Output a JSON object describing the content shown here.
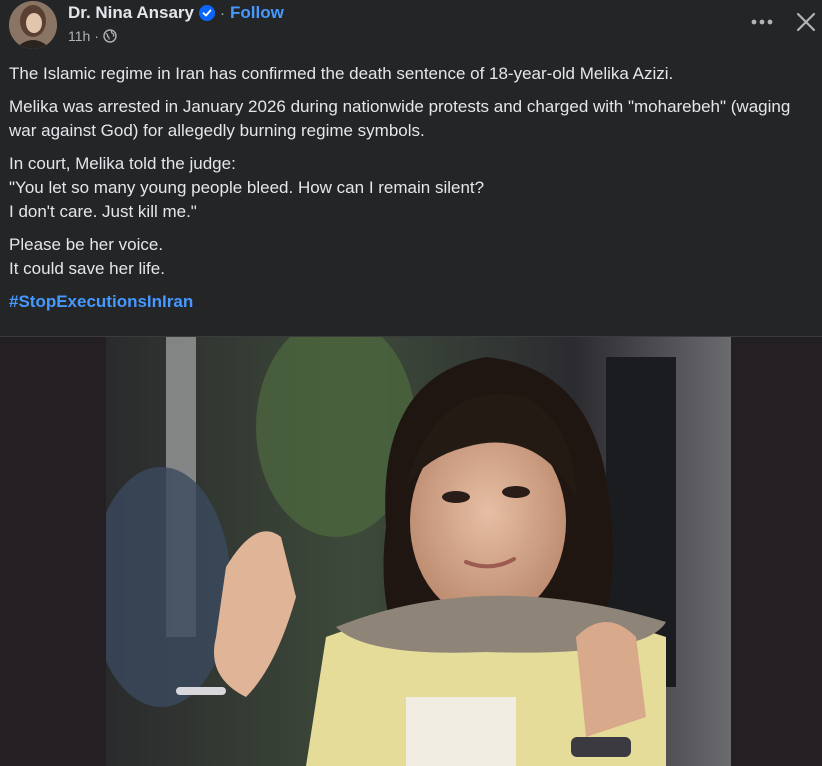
{
  "post": {
    "author": "Dr. Nina Ansary",
    "verified_icon": "verified-badge-icon",
    "separator": "·",
    "follow_label": "Follow",
    "time": "11h",
    "time_separator": "·",
    "audience_icon": "globe-icon",
    "paragraphs": [
      "The Islamic regime in Iran has confirmed the death sentence of 18-year-old Melika Azizi.",
      "Melika was arrested in January 2026 during nationwide protests and charged with \"moharebeh\" (waging war against God) for allegedly burning regime symbols."
    ],
    "quote_intro": "In court, Melika told the judge:",
    "quote_line1": "\"You let so many young people bleed. How can I remain silent?",
    "quote_line2": "I don't care. Just kill me.\"",
    "appeal_line1": "Please be her voice.",
    "appeal_line2": "It could save her life.",
    "hashtag": "#StopExecutionsInIran"
  },
  "colors": {
    "background": "#242526",
    "text": "#e4e6eb",
    "secondary_text": "#b0b3b8",
    "link": "#4599ff",
    "verified": "#0866ff"
  },
  "icons": {
    "more": "more-options-icon",
    "close": "close-icon"
  }
}
